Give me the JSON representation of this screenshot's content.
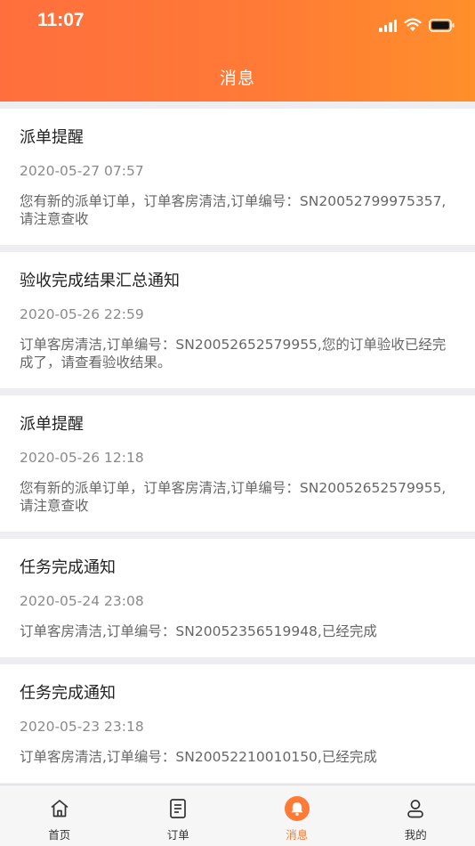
{
  "status_bar": {
    "time": "11:07"
  },
  "header": {
    "title": "消息"
  },
  "messages": [
    {
      "title": "派单提醒",
      "time": "2020-05-27 07:57",
      "body": "您有新的派单订单，订单客房清洁,订单编号：SN20052799975357,请注意查收"
    },
    {
      "title": "验收完成结果汇总通知",
      "time": "2020-05-26 22:59",
      "body": "订单客房清洁,订单编号：SN20052652579955,您的订单验收已经完成了，请查看验收结果。"
    },
    {
      "title": "派单提醒",
      "time": "2020-05-26 12:18",
      "body": "您有新的派单订单，订单客房清洁,订单编号：SN20052652579955,请注意查收"
    },
    {
      "title": "任务完成通知",
      "time": "2020-05-24 23:08",
      "body": "订单客房清洁,订单编号：SN20052356519948,已经完成"
    },
    {
      "title": "任务完成通知",
      "time": "2020-05-23 23:18",
      "body": "订单客房清洁,订单编号：SN20052210010150,已经完成"
    }
  ],
  "tabbar": {
    "items": [
      {
        "label": "首页",
        "icon": "home-icon"
      },
      {
        "label": "订单",
        "icon": "order-icon"
      },
      {
        "label": "消息",
        "icon": "bell-icon",
        "active": true
      },
      {
        "label": "我的",
        "icon": "user-icon"
      }
    ]
  },
  "colors": {
    "accent": "#ff7a36",
    "header_start": "#ff6f3d",
    "header_end": "#ff8f2a"
  }
}
